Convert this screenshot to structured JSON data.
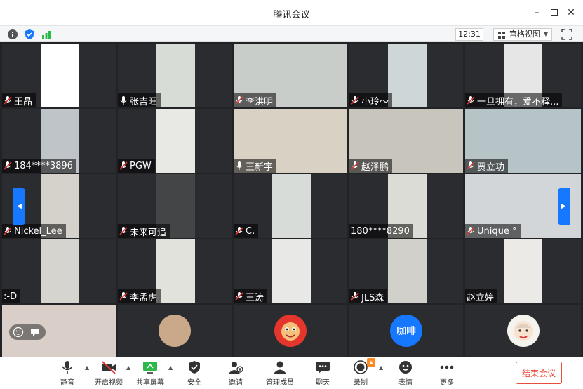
{
  "window": {
    "title": "腾讯会议"
  },
  "infobar": {
    "time": "12:31",
    "view_label": "宫格视图"
  },
  "participants": [
    {
      "name": "王晶"
    },
    {
      "name": "张吉旺"
    },
    {
      "name": "李洪明"
    },
    {
      "name": "小玲～"
    },
    {
      "name": "一旦拥有，爱不释..."
    },
    {
      "name": "184****3896"
    },
    {
      "name": "PGW"
    },
    {
      "name": "王新宇"
    },
    {
      "name": "赵泽鹏"
    },
    {
      "name": "贾立功"
    },
    {
      "name": "Nickel_Lee"
    },
    {
      "name": "未来可追"
    },
    {
      "name": "C."
    },
    {
      "name": "180****8290"
    },
    {
      "name": "Unique °"
    },
    {
      "name": ":-D"
    },
    {
      "name": "李孟虎"
    },
    {
      "name": "王涛"
    },
    {
      "name": "JLS森"
    },
    {
      "name": "赵立婷"
    }
  ],
  "bottom_avatars": {
    "coffee_text": "咖啡"
  },
  "toolbar": {
    "mute": "静音",
    "video": "开启视频",
    "share": "共享屏幕",
    "security": "安全",
    "invite": "邀请",
    "members": "管理成员",
    "chat": "聊天",
    "record": "录制",
    "reaction": "表情",
    "more": "更多",
    "end": "结束会议"
  },
  "colors": {
    "accent": "#1677ff",
    "end": "#e74c3c",
    "mic_muted": "#e53935"
  }
}
